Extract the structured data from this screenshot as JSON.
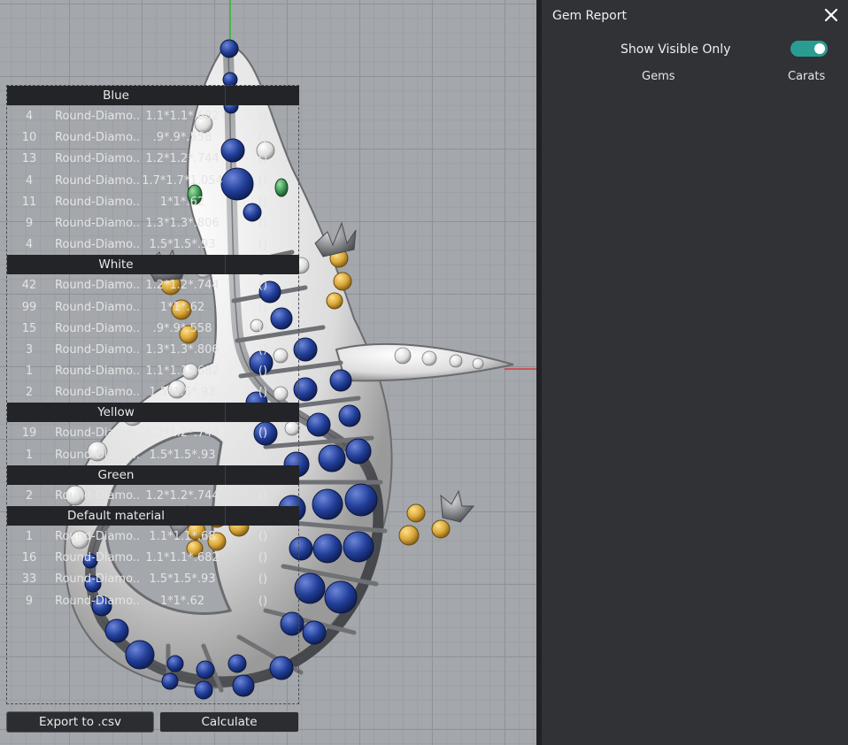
{
  "panel": {
    "title": "Gem Report",
    "show_visible_label": "Show Visible Only",
    "show_visible_on": true,
    "col_gems": "Gems",
    "col_carats": "Carats"
  },
  "groups": [
    {
      "name": "Blue",
      "rows": [
        {
          "count": "4",
          "type": "Round-Diamo...",
          "size": "1.1*1.1*.682",
          "carats": "()"
        },
        {
          "count": "10",
          "type": "Round-Diamo...",
          "size": ".9*.9*.558",
          "carats": "()"
        },
        {
          "count": "13",
          "type": "Round-Diamo...",
          "size": "1.2*1.2*.744",
          "carats": "()"
        },
        {
          "count": "4",
          "type": "Round-Diamo...",
          "size": "1.7*1.7*1.054",
          "carats": "()"
        },
        {
          "count": "11",
          "type": "Round-Diamo...",
          "size": "1*1*.62",
          "carats": "()"
        },
        {
          "count": "9",
          "type": "Round-Diamo...",
          "size": "1.3*1.3*.806",
          "carats": "()"
        },
        {
          "count": "4",
          "type": "Round-Diamo...",
          "size": "1.5*1.5*.93",
          "carats": "()"
        }
      ]
    },
    {
      "name": "White",
      "rows": [
        {
          "count": "42",
          "type": "Round-Diamo...",
          "size": "1.2*1.2*.744",
          "carats": "()"
        },
        {
          "count": "99",
          "type": "Round-Diamo...",
          "size": "1*1*.62",
          "carats": "()"
        },
        {
          "count": "15",
          "type": "Round-Diamo...",
          "size": ".9*.9*.558",
          "carats": "()"
        },
        {
          "count": "3",
          "type": "Round-Diamo...",
          "size": "1.3*1.3*.806",
          "carats": "()"
        },
        {
          "count": "1",
          "type": "Round-Diamo...",
          "size": "1.1*1.1*.682",
          "carats": "()"
        },
        {
          "count": "2",
          "type": "Round-Diamo...",
          "size": "1.5*1.5*.93",
          "carats": "()"
        }
      ]
    },
    {
      "name": "Yellow",
      "rows": [
        {
          "count": "19",
          "type": "Round-Diamo...",
          "size": "1.2*1.2*.744",
          "carats": "()"
        },
        {
          "count": "1",
          "type": "Round-Diamo...",
          "size": "1.5*1.5*.93",
          "carats": "()"
        }
      ]
    },
    {
      "name": "Green",
      "rows": [
        {
          "count": "2",
          "type": "Round-Diamo...",
          "size": "1.2*1.2*.744",
          "carats": "()"
        }
      ]
    },
    {
      "name": "Default material",
      "rows": [
        {
          "count": "1",
          "type": "Round-Diamo...",
          "size": "1.1*1.1*.68",
          "carats": "()"
        },
        {
          "count": "16",
          "type": "Round-Diamo...",
          "size": "1.1*1.1*.682",
          "carats": "()"
        },
        {
          "count": "33",
          "type": "Round-Diamo...",
          "size": "1.5*1.5*.93",
          "carats": "()"
        },
        {
          "count": "9",
          "type": "Round-Diamo...",
          "size": "1*1*.62",
          "carats": "()"
        }
      ]
    }
  ],
  "buttons": {
    "export": "Export to .csv",
    "calculate": "Calculate"
  },
  "colors": {
    "accent_toggle": "#2a9d93",
    "gem_blue": "#1f3a8f",
    "gem_white": "#e8e8e8",
    "gem_yellow": "#d9a83a",
    "gem_green": "#3f9a55",
    "metal": "#8a8c90"
  }
}
